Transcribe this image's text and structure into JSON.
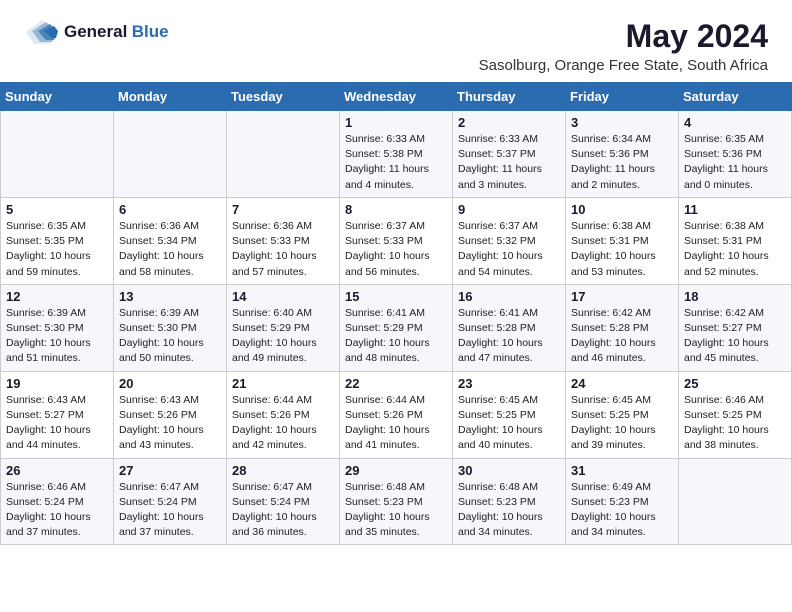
{
  "header": {
    "logo_general": "General",
    "logo_blue": "Blue",
    "main_title": "May 2024",
    "subtitle": "Sasolburg, Orange Free State, South Africa"
  },
  "calendar": {
    "weekdays": [
      "Sunday",
      "Monday",
      "Tuesday",
      "Wednesday",
      "Thursday",
      "Friday",
      "Saturday"
    ],
    "weeks": [
      [
        {
          "day": "",
          "info": ""
        },
        {
          "day": "",
          "info": ""
        },
        {
          "day": "",
          "info": ""
        },
        {
          "day": "1",
          "info": "Sunrise: 6:33 AM\nSunset: 5:38 PM\nDaylight: 11 hours\nand 4 minutes."
        },
        {
          "day": "2",
          "info": "Sunrise: 6:33 AM\nSunset: 5:37 PM\nDaylight: 11 hours\nand 3 minutes."
        },
        {
          "day": "3",
          "info": "Sunrise: 6:34 AM\nSunset: 5:36 PM\nDaylight: 11 hours\nand 2 minutes."
        },
        {
          "day": "4",
          "info": "Sunrise: 6:35 AM\nSunset: 5:36 PM\nDaylight: 11 hours\nand 0 minutes."
        }
      ],
      [
        {
          "day": "5",
          "info": "Sunrise: 6:35 AM\nSunset: 5:35 PM\nDaylight: 10 hours\nand 59 minutes."
        },
        {
          "day": "6",
          "info": "Sunrise: 6:36 AM\nSunset: 5:34 PM\nDaylight: 10 hours\nand 58 minutes."
        },
        {
          "day": "7",
          "info": "Sunrise: 6:36 AM\nSunset: 5:33 PM\nDaylight: 10 hours\nand 57 minutes."
        },
        {
          "day": "8",
          "info": "Sunrise: 6:37 AM\nSunset: 5:33 PM\nDaylight: 10 hours\nand 56 minutes."
        },
        {
          "day": "9",
          "info": "Sunrise: 6:37 AM\nSunset: 5:32 PM\nDaylight: 10 hours\nand 54 minutes."
        },
        {
          "day": "10",
          "info": "Sunrise: 6:38 AM\nSunset: 5:31 PM\nDaylight: 10 hours\nand 53 minutes."
        },
        {
          "day": "11",
          "info": "Sunrise: 6:38 AM\nSunset: 5:31 PM\nDaylight: 10 hours\nand 52 minutes."
        }
      ],
      [
        {
          "day": "12",
          "info": "Sunrise: 6:39 AM\nSunset: 5:30 PM\nDaylight: 10 hours\nand 51 minutes."
        },
        {
          "day": "13",
          "info": "Sunrise: 6:39 AM\nSunset: 5:30 PM\nDaylight: 10 hours\nand 50 minutes."
        },
        {
          "day": "14",
          "info": "Sunrise: 6:40 AM\nSunset: 5:29 PM\nDaylight: 10 hours\nand 49 minutes."
        },
        {
          "day": "15",
          "info": "Sunrise: 6:41 AM\nSunset: 5:29 PM\nDaylight: 10 hours\nand 48 minutes."
        },
        {
          "day": "16",
          "info": "Sunrise: 6:41 AM\nSunset: 5:28 PM\nDaylight: 10 hours\nand 47 minutes."
        },
        {
          "day": "17",
          "info": "Sunrise: 6:42 AM\nSunset: 5:28 PM\nDaylight: 10 hours\nand 46 minutes."
        },
        {
          "day": "18",
          "info": "Sunrise: 6:42 AM\nSunset: 5:27 PM\nDaylight: 10 hours\nand 45 minutes."
        }
      ],
      [
        {
          "day": "19",
          "info": "Sunrise: 6:43 AM\nSunset: 5:27 PM\nDaylight: 10 hours\nand 44 minutes."
        },
        {
          "day": "20",
          "info": "Sunrise: 6:43 AM\nSunset: 5:26 PM\nDaylight: 10 hours\nand 43 minutes."
        },
        {
          "day": "21",
          "info": "Sunrise: 6:44 AM\nSunset: 5:26 PM\nDaylight: 10 hours\nand 42 minutes."
        },
        {
          "day": "22",
          "info": "Sunrise: 6:44 AM\nSunset: 5:26 PM\nDaylight: 10 hours\nand 41 minutes."
        },
        {
          "day": "23",
          "info": "Sunrise: 6:45 AM\nSunset: 5:25 PM\nDaylight: 10 hours\nand 40 minutes."
        },
        {
          "day": "24",
          "info": "Sunrise: 6:45 AM\nSunset: 5:25 PM\nDaylight: 10 hours\nand 39 minutes."
        },
        {
          "day": "25",
          "info": "Sunrise: 6:46 AM\nSunset: 5:25 PM\nDaylight: 10 hours\nand 38 minutes."
        }
      ],
      [
        {
          "day": "26",
          "info": "Sunrise: 6:46 AM\nSunset: 5:24 PM\nDaylight: 10 hours\nand 37 minutes."
        },
        {
          "day": "27",
          "info": "Sunrise: 6:47 AM\nSunset: 5:24 PM\nDaylight: 10 hours\nand 37 minutes."
        },
        {
          "day": "28",
          "info": "Sunrise: 6:47 AM\nSunset: 5:24 PM\nDaylight: 10 hours\nand 36 minutes."
        },
        {
          "day": "29",
          "info": "Sunrise: 6:48 AM\nSunset: 5:23 PM\nDaylight: 10 hours\nand 35 minutes."
        },
        {
          "day": "30",
          "info": "Sunrise: 6:48 AM\nSunset: 5:23 PM\nDaylight: 10 hours\nand 34 minutes."
        },
        {
          "day": "31",
          "info": "Sunrise: 6:49 AM\nSunset: 5:23 PM\nDaylight: 10 hours\nand 34 minutes."
        },
        {
          "day": "",
          "info": ""
        }
      ]
    ]
  }
}
